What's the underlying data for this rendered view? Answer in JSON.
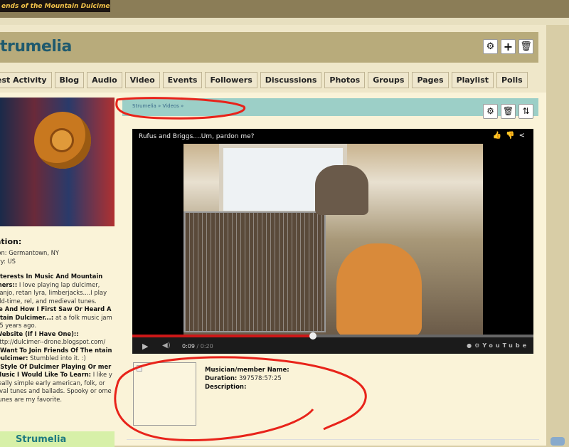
{
  "site": {
    "logo_text": "ends of the Mountain Dulcimer"
  },
  "profile": {
    "title": "trumelia"
  },
  "tabs": [
    "est Activity",
    "Blog",
    "Audio",
    "Video",
    "Events",
    "Followers",
    "Discussions",
    "Photos",
    "Groups",
    "Pages",
    "Playlist",
    "Polls"
  ],
  "sidebar": {
    "heading": "ation:",
    "location": "ion: Germantown, NY",
    "country": "try: US",
    "fields": [
      {
        "label": "nterests In Music And Mountain mers::",
        "value": " I love playing lap dulcimer, banjo, retan lyra, limberjacks....I play old-time, rel, and medieval tunes."
      },
      {
        "label": "re And How I First Saw Or Heard A ntain Dulcimer...:",
        "value": " at a folk music jam 15 years ago."
      },
      {
        "label": "Website (If I Have One)::",
        "value": " http://dulcimer--drone.blogspot.com/"
      },
      {
        "label": "I Want To Join Friends Of The ntain Dulcimer:",
        "value": " Stumbled into it. :)"
      },
      {
        "label": ": Style Of Dulcimer Playing Or mer Music I Would Like To Learn:",
        "value": " I like y really simple early american, folk, or eval tunes and ballads. Spooky or ome tunes are my favorite."
      }
    ],
    "card_name": "Strumelia"
  },
  "breadcrumb": "Strumelia » Videos »",
  "video": {
    "title": "Rufus and Briggs....Um, pardon me?",
    "current_time": "0:09",
    "separator": " / ",
    "duration": "0:20",
    "progress_percent": 45,
    "brand": "YouTube"
  },
  "details": {
    "name_label": "Musician/member Name:",
    "duration_label": "Duration:",
    "duration_value": " 397578:57:25",
    "description_label": "Description:"
  },
  "colors": {
    "title": "#1f5a6e",
    "breadcrumb_bar": "#9ccfc7",
    "annotation": "#e8231a"
  }
}
